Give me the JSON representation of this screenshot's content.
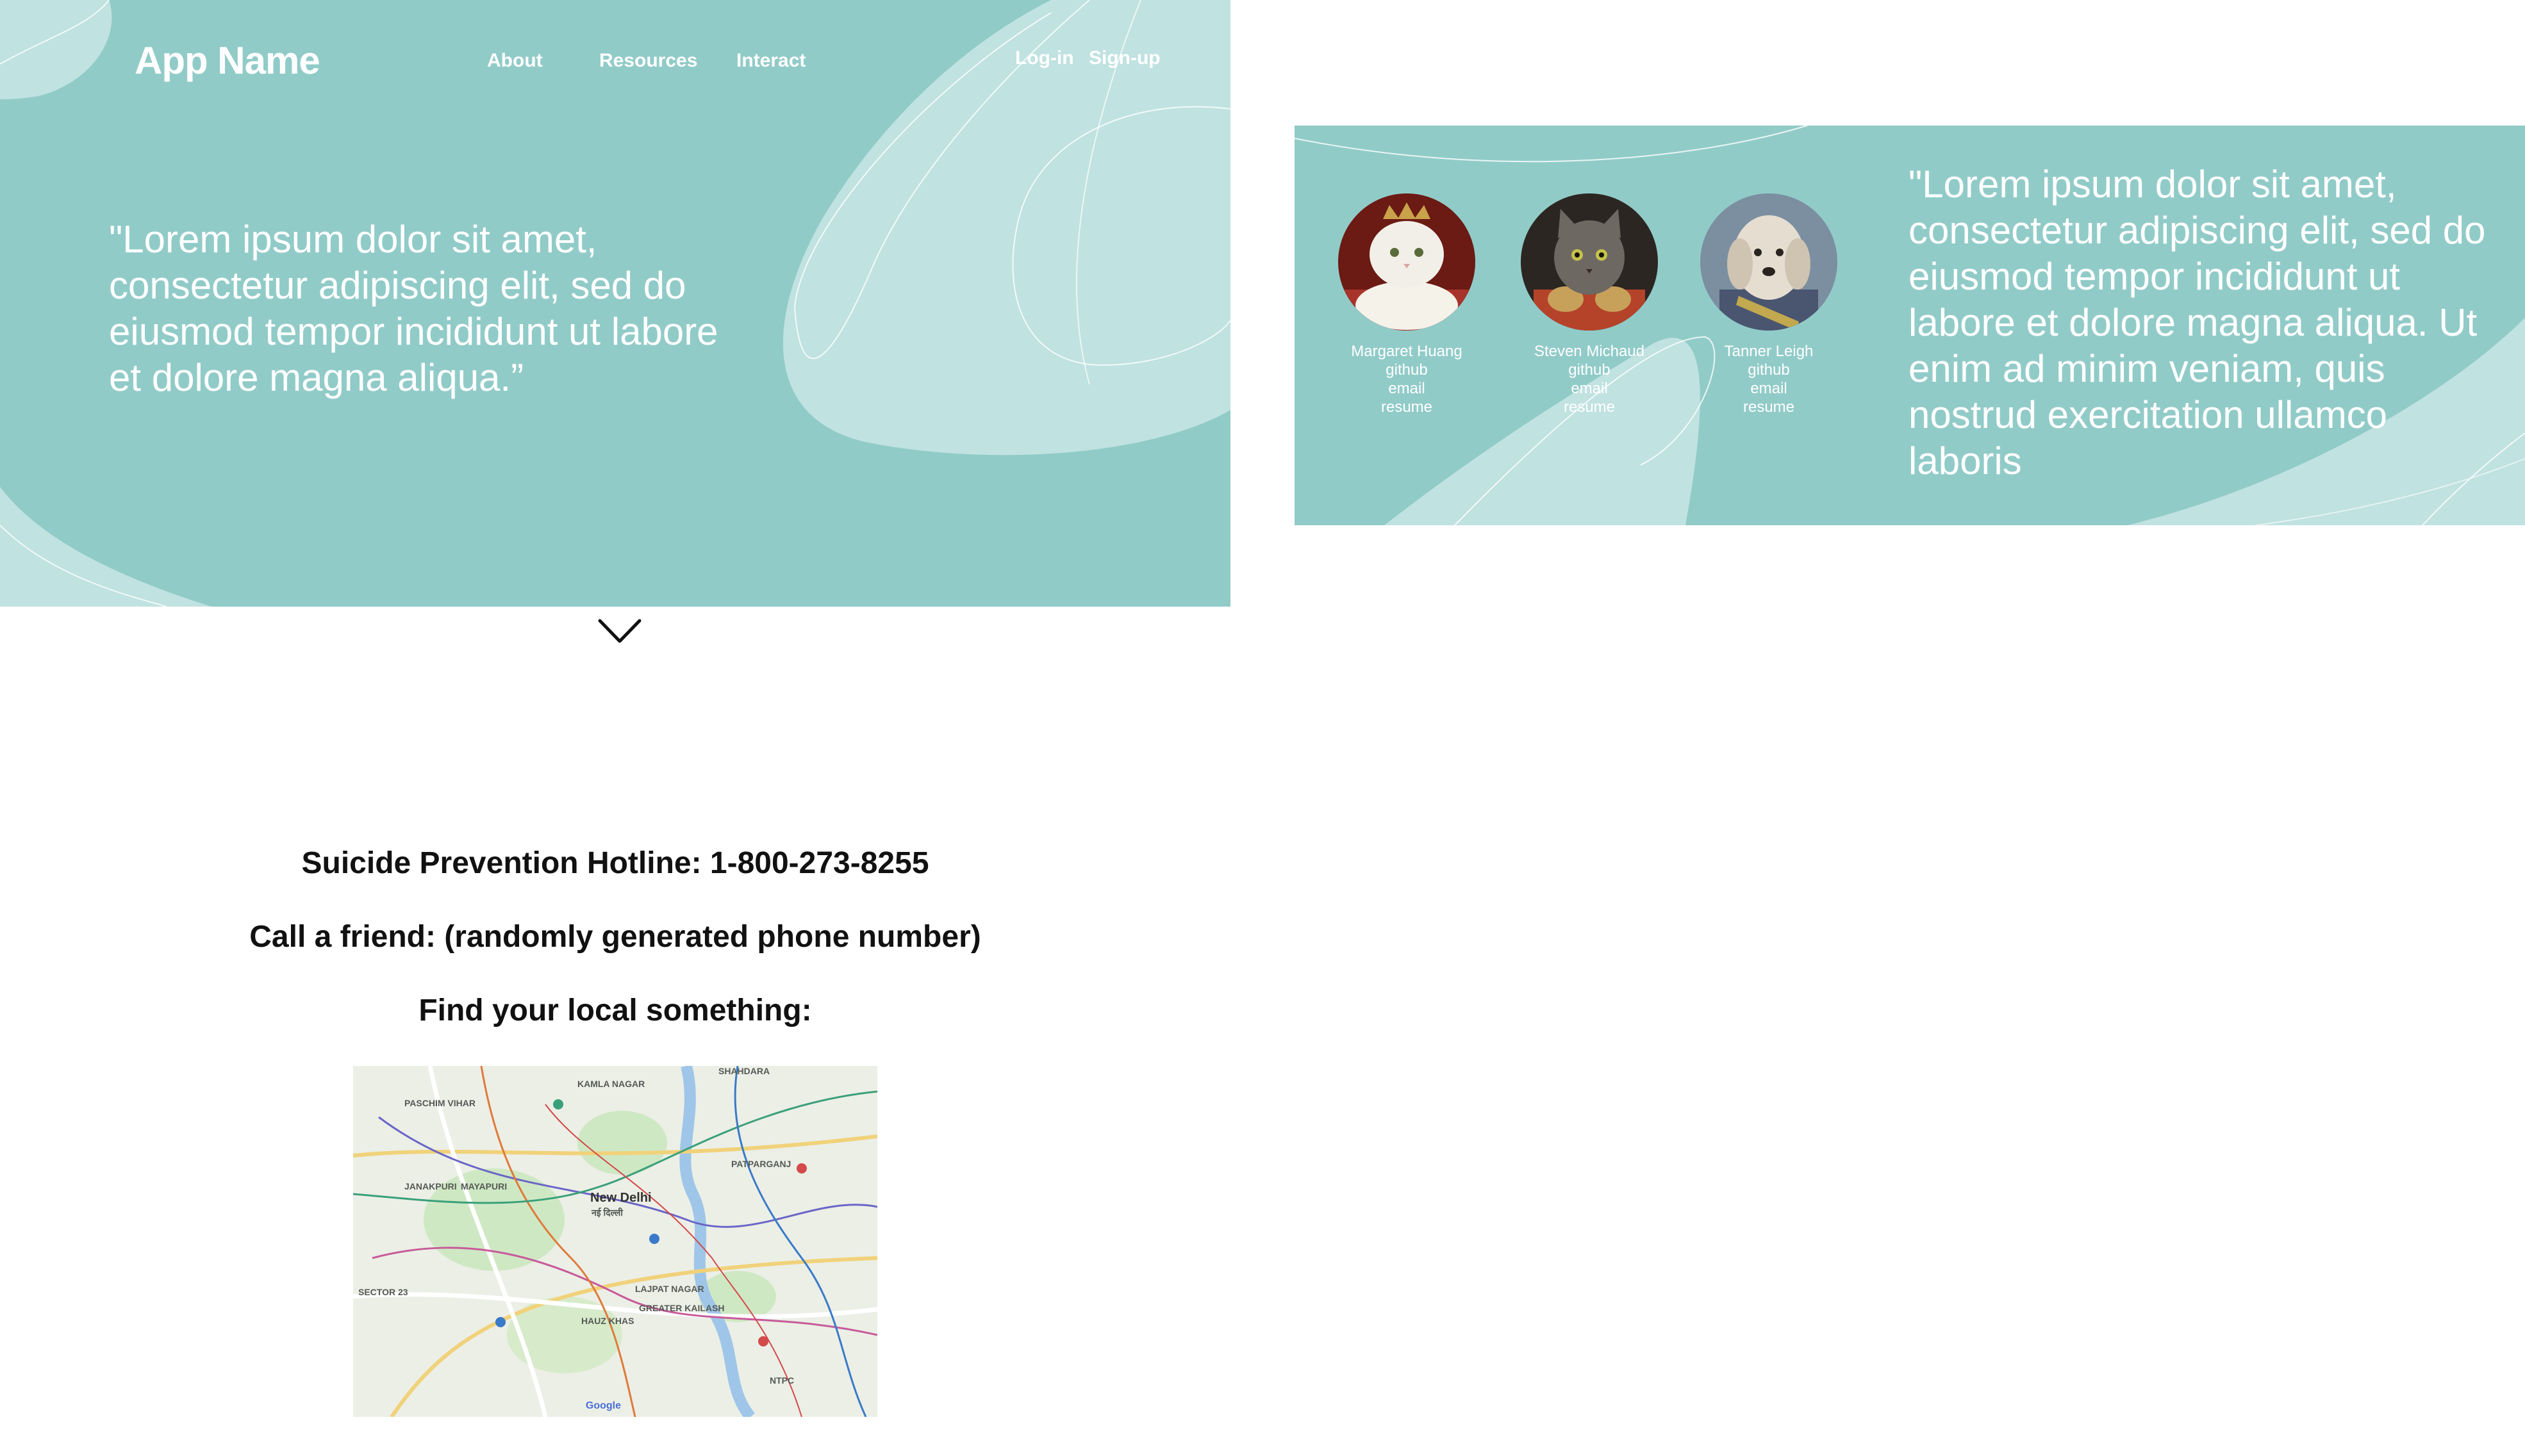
{
  "header": {
    "app_name": "App Name",
    "nav": [
      "About",
      "Resources",
      "Interact"
    ],
    "auth": [
      "Log-in",
      "Sign-up"
    ]
  },
  "hero": {
    "quote": "\"Lorem ipsum dolor sit amet, consectetur adipiscing elit, sed do eiusmod tempor incididunt ut labore et dolore magna aliqua.”"
  },
  "team": {
    "members": [
      {
        "name": "Margaret Huang",
        "links": [
          "github",
          "email",
          "resume"
        ],
        "avatar": "white-persian-cat-portrait"
      },
      {
        "name": "Steven Michaud",
        "links": [
          "github",
          "email",
          "resume"
        ],
        "avatar": "tabby-cat-portrait"
      },
      {
        "name": "Tanner Leigh",
        "links": [
          "github",
          "email",
          "resume"
        ],
        "avatar": "terrier-dog-portrait"
      }
    ],
    "quote": "\"Lorem ipsum dolor sit amet, consectetur adipiscing elit, sed do eiusmod tempor incididunt ut labore et dolore magna aliqua. Ut enim ad minim veniam, quis nostrud exercitation ullamco laboris"
  },
  "scroll_icon": "chevron-down-icon",
  "info": {
    "hotline": "Suicide Prevention Hotline: 1-800-273-8255",
    "friend": "Call a friend: (randomly generated phone number)",
    "local": "Find your local something:"
  },
  "map": {
    "labels": [
      "SHAHDARA",
      "KAMLA NAGAR",
      "PASCHIM VIHAR",
      "PATPARGANJ",
      "JANAKPURI",
      "MAYAPURI",
      "New Delhi",
      "नई दिल्ली",
      "SECTOR 23",
      "LAJPAT NAGAR",
      "HAUZ KHAS",
      "GREATER KAILASH",
      "NTPC"
    ],
    "logo": "Google"
  },
  "colors": {
    "panel": "#91cbc8",
    "panel_light": "#c0e2e1",
    "text_dark": "#111111"
  }
}
